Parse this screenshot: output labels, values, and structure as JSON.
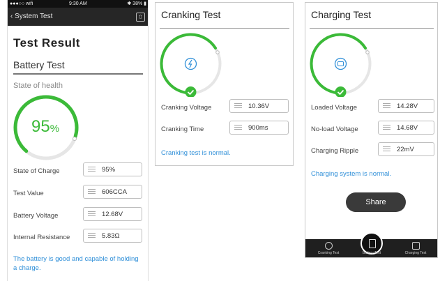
{
  "status": {
    "left": "●●●○○ wifi",
    "time": "9:30 AM",
    "right": "✱ 38% ▮"
  },
  "nav": {
    "back_label": "‹ System Test",
    "icon": "share-square-icon"
  },
  "battery": {
    "heading": "Test Result",
    "subheading": "Battery Test",
    "state_label": "State of health",
    "health_percent": 95,
    "health_value": "95",
    "health_unit": "%",
    "rows": [
      {
        "label": "State of Charge",
        "value": "95%"
      },
      {
        "label": "Test Value",
        "value": "606CCA"
      },
      {
        "label": "Battery Voltage",
        "value": "12.68V"
      },
      {
        "label": "Internal Resistance",
        "value": "5.83Ω"
      }
    ],
    "message": "The battery is good and capable of holding a charge."
  },
  "cranking": {
    "title": "Cranking Test",
    "gauge_icon": "lightning-icon",
    "rows": [
      {
        "label": "Cranking Voltage",
        "value": "10.36V"
      },
      {
        "label": "Cranking Time",
        "value": "900ms"
      }
    ],
    "message": "Cranking test is normal."
  },
  "charging": {
    "title": "Charging Test",
    "gauge_icon": "plug-icon",
    "rows": [
      {
        "label": "Loaded Voltage",
        "value": "14.28V"
      },
      {
        "label": "No-load Voltage",
        "value": "14.68V"
      },
      {
        "label": "Charging Ripple",
        "value": "22mV"
      }
    ],
    "message": "Charging system is normal.",
    "share_label": "Share",
    "tabs": [
      {
        "label": "Cranking Test",
        "icon": "clock-icon"
      },
      {
        "label": "Battery Test",
        "icon": "battery-icon"
      },
      {
        "label": "Charging Test",
        "icon": "charger-icon"
      }
    ]
  },
  "colors": {
    "accent_green": "#3bba38",
    "link_blue": "#2f8fd8",
    "dark_bar": "#262626"
  }
}
